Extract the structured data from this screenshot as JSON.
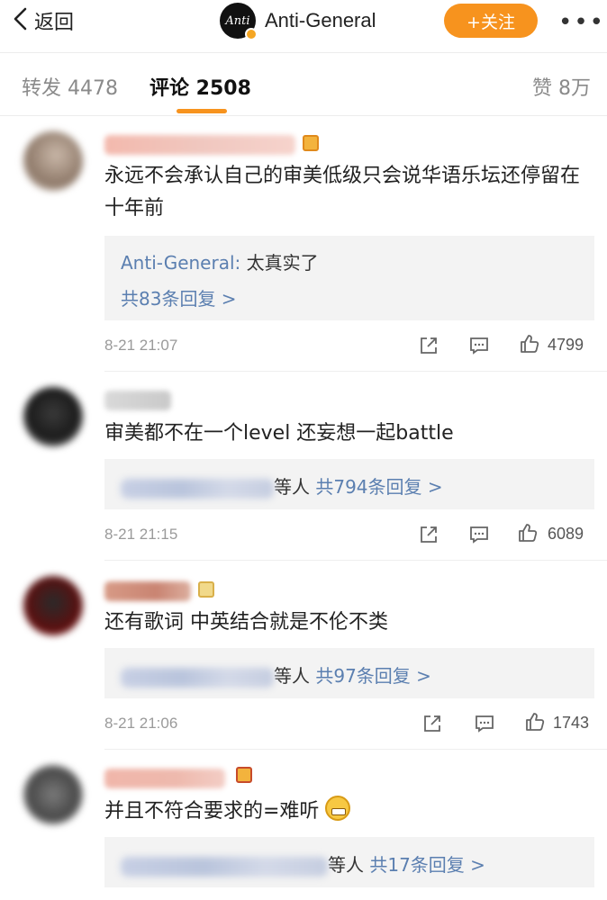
{
  "header": {
    "back_label": "返回",
    "account_name": "Anti-General",
    "avatar_logo": "Anti",
    "follow_label": "+关注",
    "more_label": "•••"
  },
  "tabs": {
    "repost": "转发 4478",
    "comments": "评论 2508",
    "likes": "赞 8万"
  },
  "comments": [
    {
      "text": "永远不会承认自己的审美低级只会说华语乐坛还停留在十年前",
      "reply_author": "Anti-General:",
      "reply_text": " 太真实了",
      "reply_more": "共83条回复 >",
      "time": "8-21 21:07",
      "likes": "4799"
    },
    {
      "text": "审美都不在一个level 还妄想一起battle",
      "reply_suffix": "等人",
      "reply_more": " 共794条回复 >",
      "time": "8-21 21:15",
      "likes": "6089"
    },
    {
      "text": "还有歌词 中英结合就是不伦不类",
      "reply_suffix": "等人",
      "reply_more": " 共97条回复 >",
      "time": "8-21 21:06",
      "likes": "1743"
    },
    {
      "text": "并且不符合要求的=难听",
      "reply_suffix": "等人",
      "reply_more": " 共17条回复 >"
    }
  ],
  "colors": {
    "accent": "#f7931e",
    "link": "#5b7fb0",
    "reply_bg": "#f3f3f3"
  },
  "icons": [
    "chevron-left-icon",
    "share-icon",
    "comment-icon",
    "thumbs-up-icon"
  ]
}
